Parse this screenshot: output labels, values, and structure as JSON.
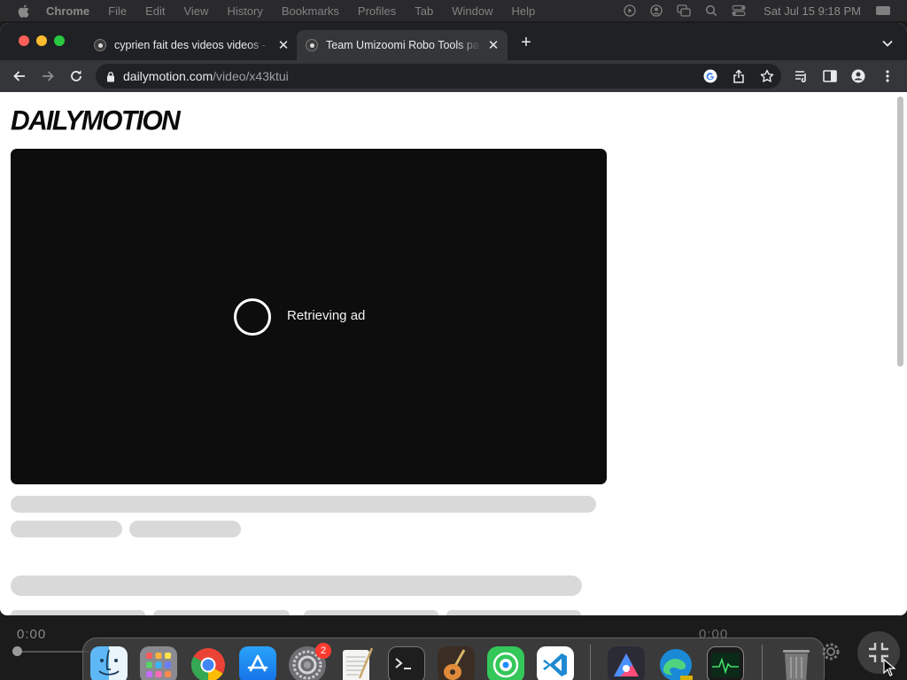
{
  "menubar": {
    "app_name": "Chrome",
    "items": [
      "File",
      "Edit",
      "View",
      "History",
      "Bookmarks",
      "Profiles",
      "Tab",
      "Window",
      "Help"
    ],
    "clock": "Sat Jul 15  9:18 PM"
  },
  "tabs": [
    {
      "title": "cyprien fait des videos videos - ",
      "active": false
    },
    {
      "title": "Team Umizoomi Robo Tools par",
      "active": true
    }
  ],
  "omnibox": {
    "domain": "dailymotion.com",
    "path": "/video/x43ktui"
  },
  "page": {
    "logo": "DAILYMOTION",
    "player_status": "Retrieving ad"
  },
  "overlay": {
    "time_left": "0:00",
    "time_right": "0:00"
  },
  "dock": {
    "apps": [
      "finder-icon",
      "launchpad-icon",
      "chrome-icon",
      "app-store-icon",
      "system-settings-icon",
      "textedit-icon",
      "terminal-icon",
      "garageband-icon",
      "find-my-icon",
      "vscode-icon",
      "affinity-icon",
      "edge-icon",
      "activity-monitor-icon",
      "trash-icon"
    ],
    "settings_badge": "2"
  },
  "colors": {
    "tabstrip": "#202124",
    "toolbar": "#35363a",
    "player_bg": "#0d0d0d",
    "skeleton": "#d9d9d9"
  }
}
